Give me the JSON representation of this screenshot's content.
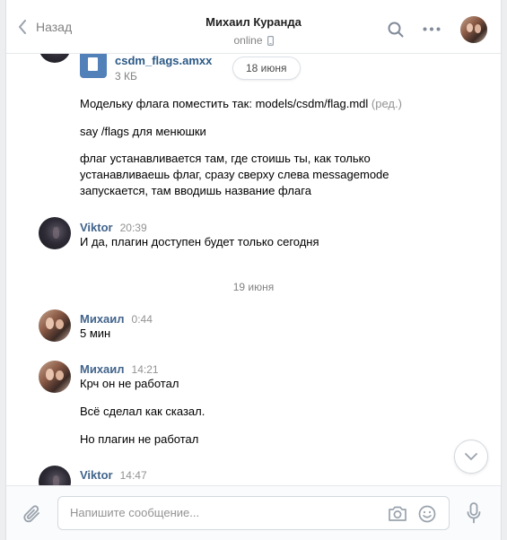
{
  "header": {
    "back_label": "Назад",
    "contact_name": "Михаил Куранда",
    "status": "online"
  },
  "messages": {
    "doc": {
      "name": "csdm_flags.amxx",
      "size": "3 КБ"
    },
    "date_pill": "18 июня",
    "text1": "Модельку флага поместить так: models/csdm/flag.mdl",
    "text1_edited": "(ред.)",
    "text2": "say /flags для менюшки",
    "text3_line1": "флаг устанавливается там, где стоишь ты, как только",
    "text3_line2": "устанавливаешь флаг, сразу сверху слева messagemode",
    "text3_line3": "запускается, там вводишь название флага",
    "group1": {
      "author": "Viktor",
      "time": "20:39",
      "text": "И да, плагин доступен будет только сегодня"
    },
    "date_separator": "19 июня",
    "group2": {
      "author": "Михаил",
      "time": "0:44",
      "text": "5 мин"
    },
    "group3": {
      "author": "Михаил",
      "time": "14:21",
      "text1": "Крч он не работал",
      "text2": "Всё сделал как сказал.",
      "text3": "Но плагин не работал"
    },
    "group4": {
      "author": "Viktor",
      "time": "14:47"
    }
  },
  "composer": {
    "placeholder": "Напишите сообщение..."
  },
  "icons": {
    "back": "chevron-left-icon",
    "search": "search-icon",
    "more": "more-icon",
    "phone": "mobile-phone-icon",
    "attach": "paperclip-icon",
    "camera": "camera-icon",
    "smile": "smile-icon",
    "mic": "microphone-icon",
    "scroll": "chevron-down-icon"
  },
  "colors": {
    "link": "#42648b",
    "doc_icon": "#5181b8",
    "muted": "#828282"
  }
}
